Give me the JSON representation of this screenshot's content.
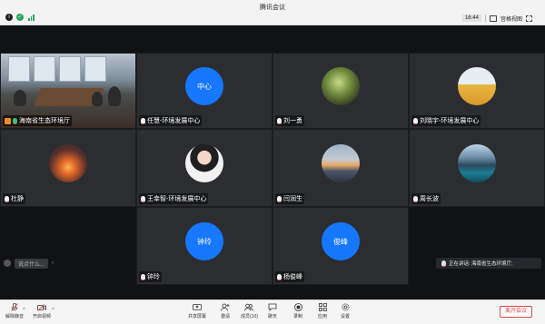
{
  "window": {
    "title": "腾讯会议"
  },
  "titlebar": {
    "time": "16:44",
    "view_label": "宫格视图"
  },
  "participants": [
    {
      "name": "海南省生态环境厅",
      "type": "video"
    },
    {
      "name": "任慧-环境发展中心",
      "type": "initials",
      "initials": "中心",
      "color": "#1677ff"
    },
    {
      "name": "刘一勇",
      "type": "photo"
    },
    {
      "name": "刘晓宇-环境发展中心",
      "type": "photo"
    },
    {
      "name": "杜静",
      "type": "photo"
    },
    {
      "name": "王幸智-环境发展中心",
      "type": "photo"
    },
    {
      "name": "闫润生",
      "type": "photo"
    },
    {
      "name": "周长波",
      "type": "photo"
    },
    {
      "name": "钟玲",
      "type": "initials",
      "initials": "钟玲",
      "color": "#1677ff"
    },
    {
      "name": "杨俊峰",
      "type": "initials",
      "initials": "俊峰",
      "color": "#1677ff"
    }
  ],
  "chat": {
    "placeholder": "说点什么..."
  },
  "speaking": {
    "text": "正在讲话: 海南省生态环境厅;"
  },
  "toolbar": {
    "mute_label": "解除静音",
    "video_label": "开启视频",
    "share_label": "共享屏幕",
    "invite_label": "邀请",
    "members_label": "成员(10)",
    "chat_label": "聊天",
    "record_label": "录制",
    "apps_label": "应用",
    "settings_label": "设置",
    "leave_label": "离开会议"
  }
}
